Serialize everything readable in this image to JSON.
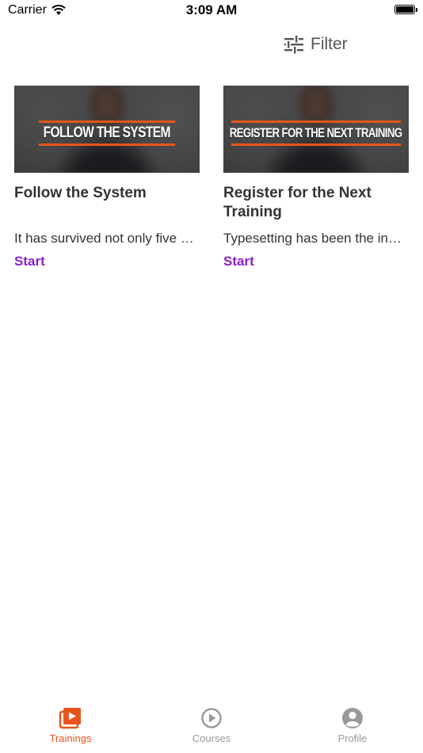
{
  "status_bar": {
    "carrier": "Carrier",
    "time": "3:09 AM"
  },
  "filter": {
    "label": "Filter",
    "icon": "sliders-icon"
  },
  "cards": [
    {
      "banner_text": "FOLLOW THE SYSTEM",
      "title": "Follow the System",
      "description": "It has survived not only five centuries",
      "action": "Start"
    },
    {
      "banner_text": "REGISTER FOR THE NEXT TRAINING",
      "title": "Register for the Next Training",
      "description": "Typesetting has been the industry standard",
      "action": "Start"
    }
  ],
  "tabs": [
    {
      "label": "Trainings",
      "icon": "trainings-icon",
      "active": true
    },
    {
      "label": "Courses",
      "icon": "play-circle-icon",
      "active": false
    },
    {
      "label": "Profile",
      "icon": "user-circle-icon",
      "active": false
    }
  ],
  "colors": {
    "accent": "#e8541c",
    "action": "#8b1ec9",
    "inactive": "#999999"
  }
}
